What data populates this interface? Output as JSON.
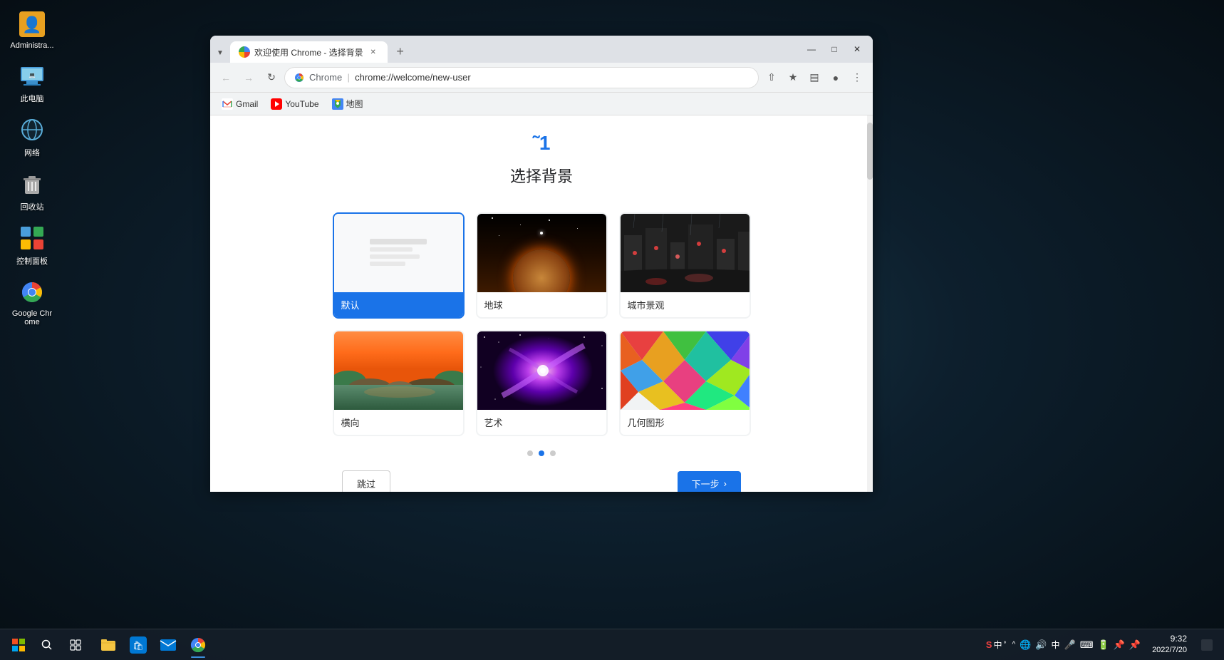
{
  "desktop": {
    "background": "dark blue-green space",
    "icons": [
      {
        "id": "administrator",
        "label": "Administra...",
        "icon": "👤",
        "color": "#f0a030"
      },
      {
        "id": "this-computer",
        "label": "此电脑",
        "icon": "💻",
        "color": "#4a9eda"
      },
      {
        "id": "network",
        "label": "网络",
        "icon": "🌐",
        "color": "#5aadda"
      },
      {
        "id": "recycle-bin",
        "label": "回收站",
        "icon": "🗑️",
        "color": "#aaa"
      },
      {
        "id": "control-panel",
        "label": "控制面板",
        "icon": "⚙️",
        "color": "#4a9eda"
      },
      {
        "id": "google-chrome",
        "label": "Google Chrome",
        "icon": "chrome",
        "color": ""
      }
    ]
  },
  "chrome_window": {
    "tab": {
      "title": "欢迎使用 Chrome - 选择背景",
      "favicon": "chrome"
    },
    "toolbar": {
      "back_disabled": true,
      "forward_disabled": true,
      "url": "chrome://welcome/new-user",
      "url_display": "Chrome  |  chrome://welcome/new-user"
    },
    "bookmarks": [
      {
        "label": "Gmail",
        "favicon": "gmail"
      },
      {
        "label": "YouTube",
        "favicon": "youtube"
      },
      {
        "label": "地图",
        "favicon": "maps"
      }
    ],
    "page": {
      "title": "选择背景",
      "backgrounds": [
        {
          "id": "default",
          "label": "默认",
          "selected": true,
          "type": "default"
        },
        {
          "id": "earth",
          "label": "地球",
          "selected": false,
          "type": "earth"
        },
        {
          "id": "city",
          "label": "城市景观",
          "selected": false,
          "type": "city"
        },
        {
          "id": "landscape",
          "label": "横向",
          "selected": false,
          "type": "landscape"
        },
        {
          "id": "art",
          "label": "艺术",
          "selected": false,
          "type": "art"
        },
        {
          "id": "geometric",
          "label": "几何图形",
          "selected": false,
          "type": "geometric"
        }
      ],
      "pagination": {
        "dots": 3,
        "active": 1
      },
      "buttons": {
        "skip": "跳过",
        "next": "下一步"
      }
    }
  },
  "taskbar": {
    "time": "9:32",
    "date": "2022/7/20",
    "apps": [
      {
        "id": "file-explorer",
        "icon": "📁"
      },
      {
        "id": "store",
        "icon": "🛍️"
      },
      {
        "id": "mail",
        "icon": "✉️"
      },
      {
        "id": "chrome",
        "icon": "chrome"
      }
    ],
    "tray_icons": [
      "^",
      "🔊",
      "中",
      "🎤",
      "⌨",
      "🔋",
      "📌",
      "📌"
    ],
    "sougou": "S中°"
  }
}
